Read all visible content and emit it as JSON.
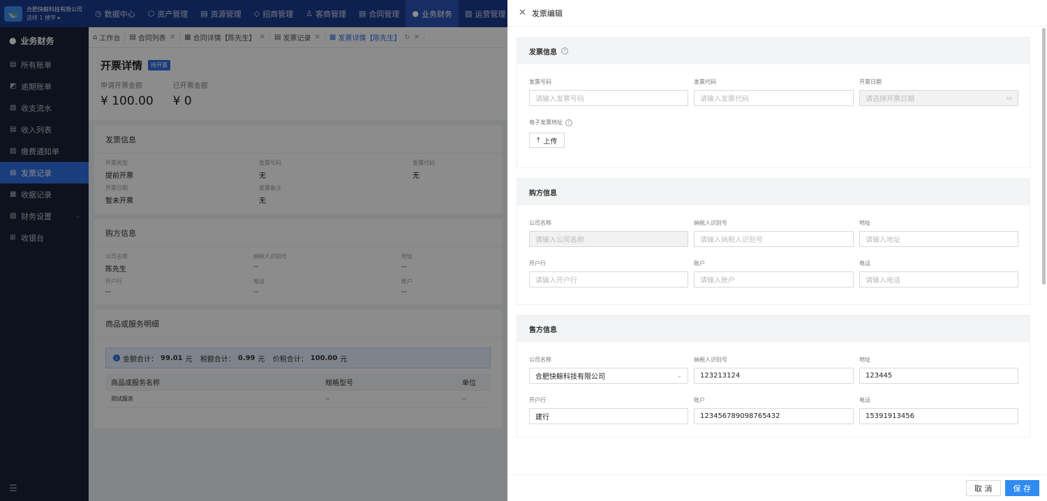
{
  "brand": {
    "company": "合肥快鲸科技有限公司",
    "building": "选择 1 楼宇 ▸"
  },
  "topnav": [
    {
      "icon": "◷",
      "label": "数据中心"
    },
    {
      "icon": "⬡",
      "label": "资产管理"
    },
    {
      "icon": "▤",
      "label": "资源管理"
    },
    {
      "icon": "◇",
      "label": "招商管理"
    },
    {
      "icon": "♙",
      "label": "客商管理"
    },
    {
      "icon": "▤",
      "label": "合同管理"
    },
    {
      "icon": "●",
      "label": "业务财务"
    },
    {
      "icon": "▨",
      "label": "运营管理"
    }
  ],
  "sidebar": {
    "header": "业务财务",
    "items": [
      {
        "label": "所有账单"
      },
      {
        "label": "逾期账单"
      },
      {
        "label": "收支流水"
      },
      {
        "label": "收入列表"
      },
      {
        "label": "缴费通知单"
      },
      {
        "label": "发票记录"
      },
      {
        "label": "收据记录"
      },
      {
        "label": "财务设置"
      },
      {
        "label": "收银台"
      }
    ],
    "collapse_icon": "☰"
  },
  "tabs": [
    {
      "label": "工作台"
    },
    {
      "label": "合同列表"
    },
    {
      "label": "合同详情【陈先生】"
    },
    {
      "label": "发票记录"
    },
    {
      "label": "发票详情【陈先生】"
    }
  ],
  "detail": {
    "title": "开票详情",
    "status": "待开票",
    "apply_amount_label": "申请开票金额",
    "apply_amount": "¥ 100.00",
    "issued_amount_label": "已开票金额",
    "issued_amount": "¥ 0",
    "invoice_section": "发票信息",
    "invoice_fields": [
      {
        "label": "开票类型",
        "value": "提前开票"
      },
      {
        "label": "发票号码",
        "value": "无"
      },
      {
        "label": "发票代码",
        "value": "无"
      },
      {
        "label": "开票日期",
        "value": "暂未开票"
      },
      {
        "label": "发票备注",
        "value": "无"
      }
    ],
    "buyer_section": "购方信息",
    "buyer_fields": [
      {
        "label": "公司名称",
        "value": "陈先生"
      },
      {
        "label": "纳税人识别号",
        "value": "--"
      },
      {
        "label": "地址",
        "value": "--"
      },
      {
        "label": "开户行",
        "value": "--"
      },
      {
        "label": "电话",
        "value": "--"
      },
      {
        "label": "账户",
        "value": "--"
      }
    ],
    "goods_section": "商品或服务明细",
    "notice": {
      "amount_label": "金额合计：",
      "amount": "99.01",
      "unit1": " 元",
      "tax_label": "税额合计：",
      "tax": "0.99",
      "unit2": " 元",
      "total_label": "价税合计：",
      "total": "100.00",
      "unit3": " 元"
    },
    "table_headers": [
      "商品或服务名称",
      "规格型号",
      "单位"
    ],
    "table_rows": [
      [
        "测试服务",
        "--",
        "--"
      ]
    ]
  },
  "drawer": {
    "title": "发票编辑",
    "invoice_section": {
      "title": "发票信息",
      "fields": [
        {
          "label": "发票号码",
          "placeholder": "请输入发票号码"
        },
        {
          "label": "发票代码",
          "placeholder": "请输入发票代码"
        },
        {
          "label": "开票日期",
          "placeholder": "请选择开票日期"
        }
      ],
      "upload_label": "电子发票地址",
      "upload_button": "上传"
    },
    "buyer_section": {
      "title": "购方信息",
      "fields": [
        {
          "label": "公司名称",
          "placeholder": "请输入公司名称"
        },
        {
          "label": "纳税人识别号",
          "placeholder": "请输入纳税人识别号"
        },
        {
          "label": "地址",
          "placeholder": "请输入地址"
        },
        {
          "label": "开户行",
          "placeholder": "请输入开户行"
        },
        {
          "label": "账户",
          "placeholder": "请输入账户"
        },
        {
          "label": "电话",
          "placeholder": "请输入电话"
        }
      ]
    },
    "seller_section": {
      "title": "售方信息",
      "fields": [
        {
          "label": "公司名称",
          "value": "合肥快鲸科技有限公司"
        },
        {
          "label": "纳税人识别号",
          "value": "123213124"
        },
        {
          "label": "地址",
          "value": "123445"
        },
        {
          "label": "开户行",
          "value": "建行"
        },
        {
          "label": "账户",
          "value": "123456789098765432"
        },
        {
          "label": "电话",
          "value": "15391913456"
        }
      ]
    },
    "cancel": "取 消",
    "save": "保 存"
  }
}
